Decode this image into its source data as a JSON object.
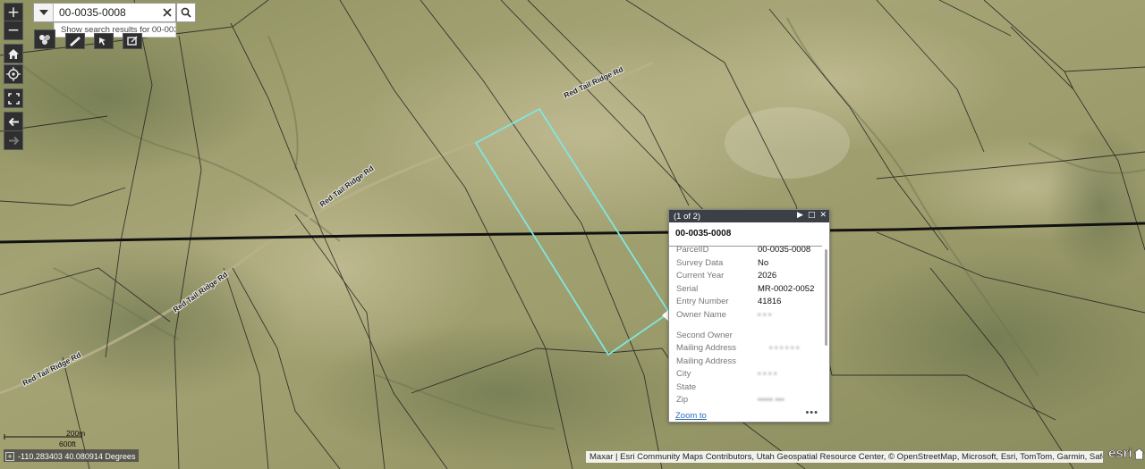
{
  "map": {
    "road_labels": [
      "Red Tail Ridge Rd",
      "Red Tail Ridge Rd",
      "Red Tail Ridge Rd",
      "Red Tail Ridge Rd"
    ],
    "parcel_color": "#7fe7e0",
    "boundary_color": "#111111"
  },
  "search": {
    "value": "00-0035-0008",
    "suggestion": "Show search results for 00-003..."
  },
  "toolbar": {
    "zoom_in": "+",
    "zoom_out": "−"
  },
  "popup": {
    "counter": "(1 of 2)",
    "title": "00-0035-0008",
    "fields": [
      {
        "label": "ParcelID",
        "value": "00-0035-0008"
      },
      {
        "label": "Survey Data",
        "value": "No"
      },
      {
        "label": "Current Year",
        "value": "2026"
      },
      {
        "label": "Serial",
        "value": "MR-0002-0052"
      },
      {
        "label": "Entry Number",
        "value": "41816"
      },
      {
        "label": "Owner Name",
        "value": ""
      },
      {
        "label": "Second Owner",
        "value": ""
      },
      {
        "label": "Mailing Address",
        "value": ""
      },
      {
        "label": "Mailing Address",
        "value": ""
      },
      {
        "label": "City",
        "value": ""
      },
      {
        "label": "State",
        "value": ""
      },
      {
        "label": "Zip",
        "value": ""
      }
    ],
    "zoom_label": "Zoom to",
    "more_label": "•••"
  },
  "scale": {
    "upper": "200m",
    "lower": "600ft"
  },
  "coordinates": "-110.283403 40.080914 Degrees",
  "attribution": "Maxar | Esri Community Maps Contributors, Utah Geospatial Resource Center, © OpenStreetMap, Microsoft, Esri, TomTom, Garmin, SafeGraph, ..."
}
